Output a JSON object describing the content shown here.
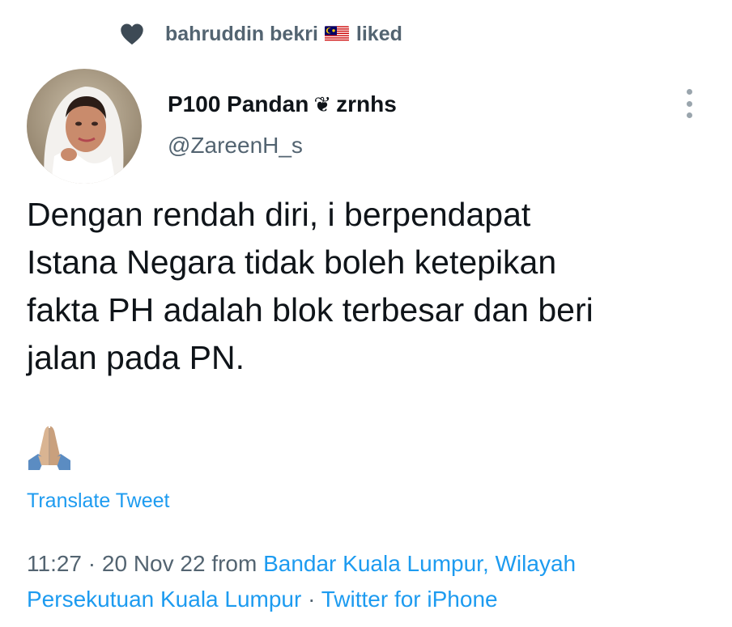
{
  "liked_by": {
    "name": "bahruddin bekri",
    "flag_icon": "malaysia-flag-icon",
    "action": "liked"
  },
  "tweet": {
    "author_name": "P100 Pandan",
    "author_heart": "❦",
    "author_name_suffix": "zrnhs",
    "author_handle": "@ZareenH_s",
    "text_lines": [
      "Dengan rendah diri, i berpendapat",
      "Istana Negara tidak boleh ketepikan",
      "fakta PH adalah blok terbesar dan beri",
      "jalan pada PN."
    ],
    "emoji_icon": "folded-hands-emoji",
    "translate_label": "Translate Tweet",
    "time": "11:27",
    "date": "20 Nov 22",
    "from_label": "from",
    "location_line1": "Bandar Kuala Lumpur, Wilayah",
    "location_line2": "Persekutuan Kuala Lumpur",
    "separator": "·",
    "client": "Twitter for iPhone"
  },
  "colors": {
    "accent": "#1d9bf0",
    "secondary_text": "#536471",
    "primary_text": "#0f1419"
  }
}
